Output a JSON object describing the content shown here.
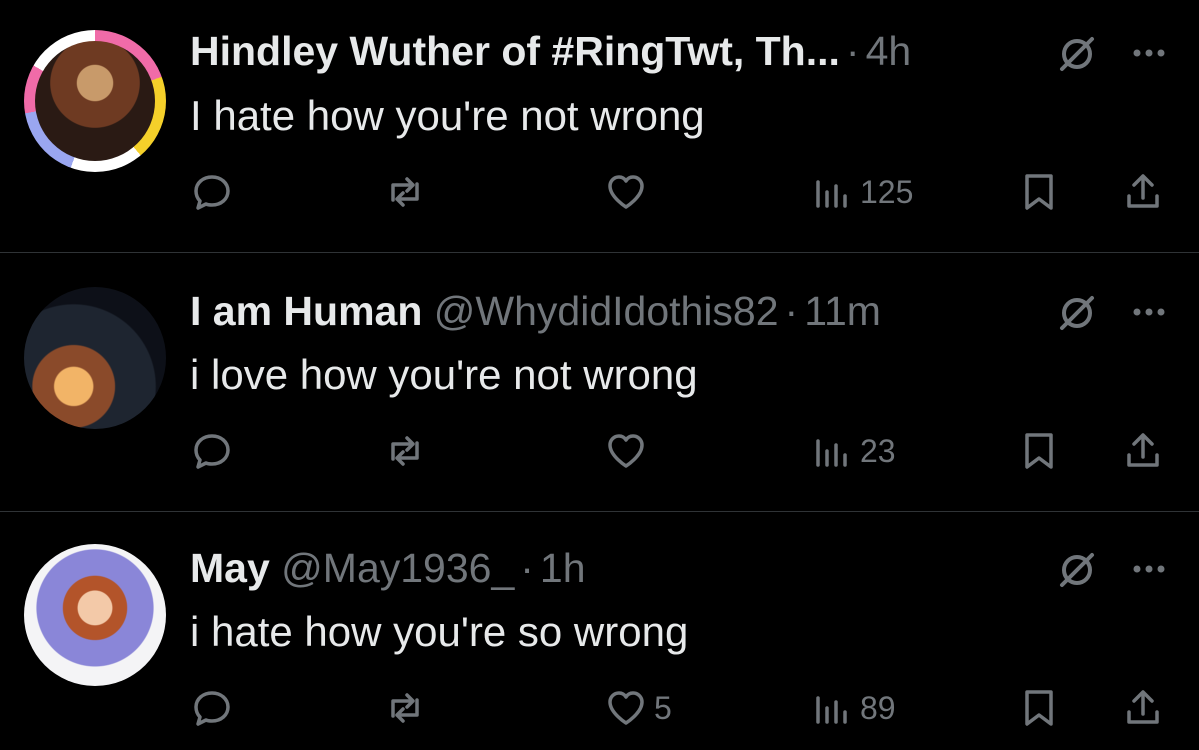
{
  "colors": {
    "background": "#000000",
    "text": "#e7e9ea",
    "muted": "#71767b",
    "divider": "#2f3336"
  },
  "tweets": [
    {
      "name": "Hindley Wuther of #RingTwt, Th...",
      "handle": "",
      "dot": "·",
      "time": "4h",
      "text": "I hate how you're not wrong",
      "likes": "",
      "views": "125"
    },
    {
      "name": "I am Human",
      "handle": "@WhydidIdothis82",
      "dot": "·",
      "time": "11m",
      "text": "i love how you're not wrong",
      "likes": "",
      "views": "23"
    },
    {
      "name": "May",
      "handle": "@May1936_",
      "dot": "·",
      "time": "1h",
      "text": "i hate how you're so wrong",
      "likes": "5",
      "views": "89"
    }
  ],
  "icons": [
    "avatar",
    "grok-icon",
    "more-icon",
    "reply-icon",
    "retweet-icon",
    "like-icon",
    "views-icon",
    "bookmark-icon",
    "share-icon"
  ]
}
